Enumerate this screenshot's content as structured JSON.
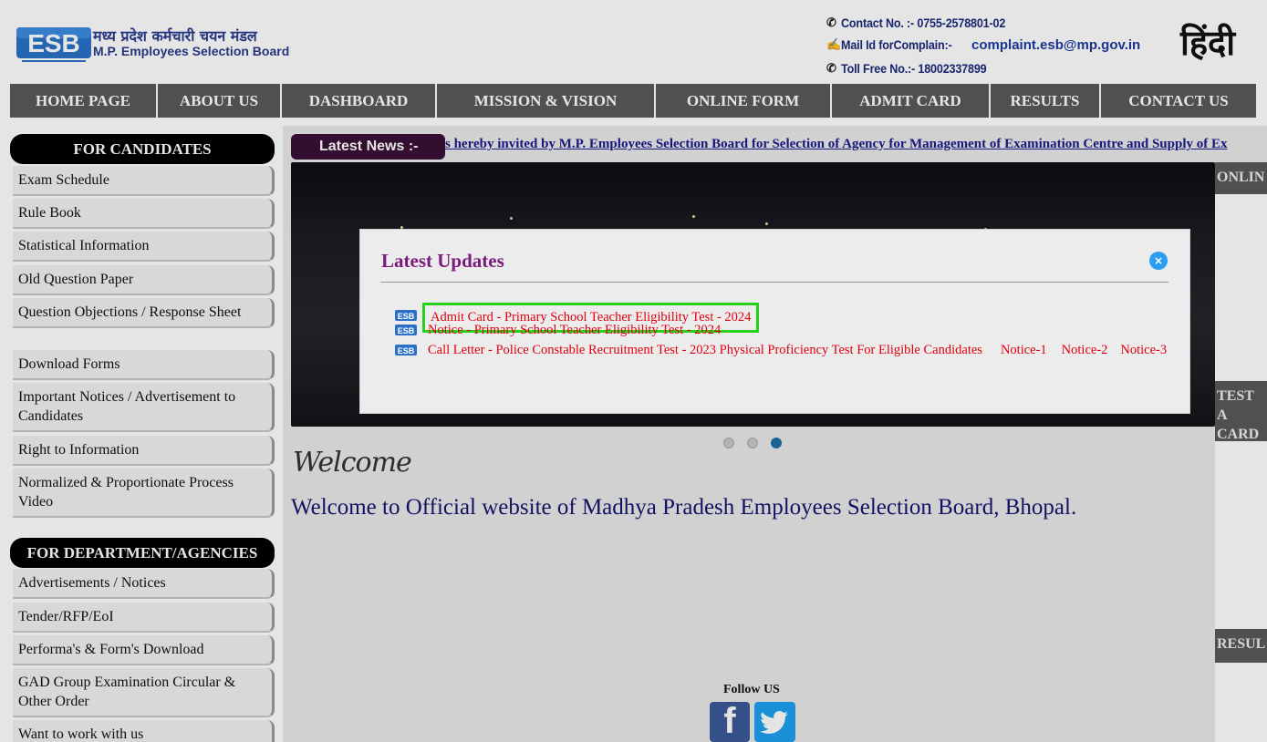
{
  "header": {
    "logo_mark": "ESB",
    "logo_hindi": "मध्य प्रदेश कर्मचारी चयन मंडल",
    "logo_english": "M.P. Employees Selection Board",
    "contact_line": "Contact No. :- 0755-2578801-02",
    "mail_label": "Mail Id forComplain:-",
    "mail_value": "complaint.esb@mp.gov.in",
    "tollfree_line": "Toll Free No.:- 18002337899",
    "hindi_button": "हिंदी"
  },
  "nav": {
    "items": [
      "HOME PAGE",
      "ABOUT US",
      "DASHBOARD",
      "MISSION & VISION",
      "ONLINE FORM",
      "ADMIT CARD",
      "RESULTS",
      "CONTACT US"
    ]
  },
  "sidebar": {
    "candidates_heading": "FOR CANDIDATES",
    "candidates_items": [
      "Exam Schedule",
      "Rule Book",
      "Statistical Information",
      "Old Question Paper",
      "Question Objections / Response Sheet",
      "Download Forms",
      "Important Notices / Advertisement to Candidates",
      "Right to Information",
      "Normalized & Proportionate Process Video"
    ],
    "department_heading": "FOR DEPARTMENT/AGENCIES",
    "department_items": [
      "Advertisements / Notices",
      "Tender/RFP/EoI",
      "Performa's & Form's Download",
      "GAD Group Examination Circular & Other Order",
      "Want to work with us"
    ]
  },
  "news": {
    "badge": "Latest News :-",
    "ticker": "s hereby invited by M.P. Employees Selection Board for Selection of Agency for Management of Examination Centre and Supply of Ex"
  },
  "right_panel": {
    "headings": [
      "ONLIN",
      "TEST A CARD",
      "RESUL"
    ]
  },
  "modal": {
    "title": "Latest Updates",
    "close_glyph": "×",
    "updates": [
      {
        "text": "Admit Card - Primary School Teacher Eligibility Test - 2024"
      },
      {
        "text": "Notice - Primary School Teacher Eligibility Test - 2024"
      },
      {
        "text": "Call Letter - Police Constable Recruitment Test - 2023 Physical Proficiency Test For Eligible Candidates",
        "links": [
          "Notice-1",
          "Notice-2",
          "Notice-3"
        ]
      }
    ]
  },
  "welcome": {
    "script": "Welcome",
    "text": "Welcome to Official website of Madhya Pradesh Employees Selection Board, Bhopal."
  },
  "footer": {
    "follow": "Follow US",
    "facebook_glyph": "f"
  },
  "colors": {
    "nav_bg": "#5a5a5a",
    "modal_title": "#7a1b7c",
    "update_text": "#e0000f",
    "highlight": "#27d11a"
  }
}
